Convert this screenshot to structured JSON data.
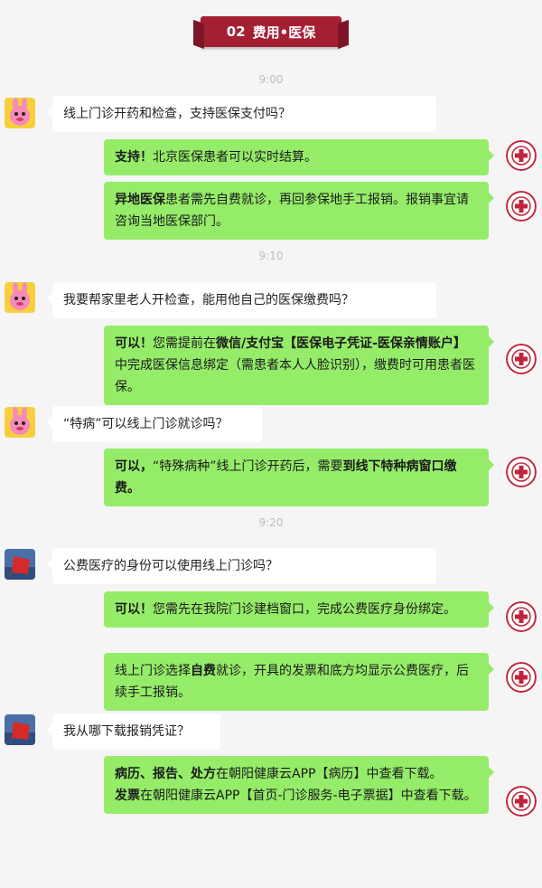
{
  "banner": {
    "number": "02",
    "title": "费用•医保"
  },
  "times": [
    "9:00",
    "9:10",
    "9:20"
  ],
  "colors": {
    "banner": "#a51f33",
    "bubble_out": "#95ec69",
    "bubble_in": "#ffffff",
    "logo": "#c0243a"
  },
  "avatars": {
    "user_a": "rabbit-avatar",
    "user_b": "red-flag-avatar",
    "hospital": "hospital-logo"
  },
  "messages": {
    "q1": "线上门诊开药和检查，支持医保支付吗？",
    "a1_bold": "支持！",
    "a1_text": "北京医保患者可以实时结算。",
    "a2_bold": "异地医保",
    "a2_text": "患者需先自费就诊，再回参保地手工报销。报销事宜请咨询当地医保部门。",
    "q2": "我要帮家里老人开检查，能用他自己的医保缴费吗？",
    "a3_bold1": "可以！",
    "a3_text1": "您需提前在",
    "a3_bold2": "微信/支付宝【医保电子凭证-医保亲情账户】",
    "a3_text2": "中完成医保信息绑定（需患者本人人脸识别），缴费时可用患者医保。",
    "q3": "“特病”可以线上门诊就诊吗？",
    "a4_bold1": "可以，",
    "a4_text1": "“特殊病种”线上门诊开药后，需要",
    "a4_bold2": "到线下特种病窗口缴费。",
    "q4": "公费医疗的身份可以使用线上门诊吗？",
    "a5_bold": "可以！",
    "a5_text": "您需先在我院门诊建档窗口，完成公费医疗身份绑定。",
    "a6_text1": "线上门诊选择",
    "a6_bold": "自费",
    "a6_text2": "就诊，开具的发票和底方均显示公费医疗，后续手工报销。",
    "q5": "我从哪下载报销凭证？",
    "a7_bold": "病历、报告、处方",
    "a7_text1": "在朝阳健康云APP【病历】中查看下载。",
    "a7_bold2": "发票",
    "a7_text2": "在朝阳健康云APP【首页-门诊服务-电子票据】中查看下载。"
  }
}
